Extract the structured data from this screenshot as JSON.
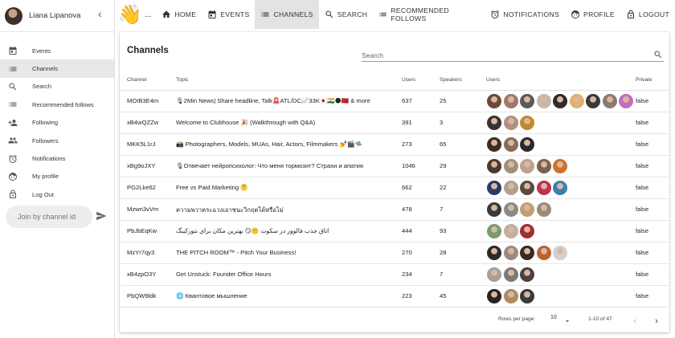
{
  "sidebar": {
    "user_name": "Liana Lipanova",
    "items": [
      {
        "label": "Events",
        "icon": "calendar-icon"
      },
      {
        "label": "Channels",
        "icon": "list-icon",
        "active": true
      },
      {
        "label": "Search",
        "icon": "search-icon"
      },
      {
        "label": "Recommended follows",
        "icon": "list-icon"
      },
      {
        "label": "Following",
        "icon": "person-add-icon"
      },
      {
        "label": "Followers",
        "icon": "people-icon"
      },
      {
        "label": "Notifications",
        "icon": "alarm-icon"
      },
      {
        "label": "My profile",
        "icon": "face-icon"
      },
      {
        "label": "Log Out",
        "icon": "lock-icon"
      }
    ],
    "join_placeholder": "Join by channel id"
  },
  "topnav": {
    "ellipsis": "...",
    "items": [
      {
        "label": "HOME",
        "icon": "home-icon"
      },
      {
        "label": "EVENTS",
        "icon": "calendar-icon"
      },
      {
        "label": "CHANNELS",
        "icon": "list-icon",
        "active": true
      },
      {
        "label": "SEARCH",
        "icon": "search-icon"
      },
      {
        "label": "RECOMMENDED FOLLOWS",
        "icon": "list-icon"
      },
      {
        "label": "NOTIFICATIONS",
        "icon": "alarm-icon"
      },
      {
        "label": "PROFILE",
        "icon": "face-icon"
      },
      {
        "label": "LOGOUT",
        "icon": "lock-icon"
      }
    ]
  },
  "main": {
    "title": "Channels",
    "search_placeholder": "Search",
    "columns": {
      "channel": "Channel",
      "topic": "Topic",
      "users": "Users",
      "speakers": "Speakers",
      "users_avatars": "Users",
      "private": "Private"
    },
    "rows": [
      {
        "channel": "MOIB3E4m",
        "topic": "🎙2Min News| Share headline, Talk🚨ATL/DC📈33K🇯🇵🇮🇳🌑🇲🇦 & more",
        "users": "637",
        "speakers": "25",
        "avatars": [
          "#6b4a3a",
          "#a07a68",
          "#5a5a5a",
          "#c9b8a8",
          "#2d2d2d",
          "#e0b070",
          "#3a3a3a",
          "#8a7a70",
          "#c070c0"
        ],
        "private": "false"
      },
      {
        "channel": "xB4wQZZw",
        "topic": "Welcome to Clubhouse 🎉 (Walkthrough with Q&A)",
        "users": "391",
        "speakers": "3",
        "avatars": [
          "#3a3030",
          "#b09080",
          "#c08a30"
        ],
        "private": "false"
      },
      {
        "channel": "MKK5L1rJ",
        "topic": "📸 Photographers, Models, MUAs, Hair, Actors, Filmmakers 💅🎬🛸",
        "users": "273",
        "speakers": "65",
        "avatars": [
          "#402a22",
          "#8a6a5a",
          "#2a2a2a"
        ],
        "private": "false"
      },
      {
        "channel": "xBg9oJXY",
        "topic": "🎙Отвечает нейропсихолог: Что меня тормозит? Страхи и апатия",
        "users": "1046",
        "speakers": "29",
        "avatars": [
          "#4a3a32",
          "#a09080",
          "#c0a090",
          "#7a6050",
          "#d07030"
        ],
        "private": "false"
      },
      {
        "channel": "PG2Lke62",
        "topic": "Free vs Paid Marketing 🤔",
        "users": "662",
        "speakers": "22",
        "avatars": [
          "#2a3a6a",
          "#b0a090",
          "#5a4a40",
          "#c03050",
          "#3a80b0"
        ],
        "private": "false"
      },
      {
        "channel": "Mzwn3vVm",
        "topic": "ความพวาคระแวงเอาชนะวิกฤตได้หรือไม่",
        "users": "478",
        "speakers": "7",
        "avatars": [
          "#3a3a3a",
          "#8a8a8a",
          "#c0a070",
          "#9a8a7a"
        ],
        "private": "false"
      },
      {
        "channel": "PbJbEqKw",
        "topic": "اتاق جذب فالوور در سکوت 🤫😏 بهترین مکان برای نتورکینگ",
        "users": "444",
        "speakers": "93",
        "avatars": [
          "#7a9a70",
          "#c0b0a0",
          "#a03030"
        ],
        "private": "false"
      },
      {
        "channel": "MzYr7qy3",
        "topic": "THE PITCH ROOM™ - Pitch Your Business!",
        "users": "270",
        "speakers": "28",
        "avatars": [
          "#2a2a2a",
          "#9a8a80",
          "#3a2a22",
          "#c06030",
          "#d0d0d0"
        ],
        "private": "false"
      },
      {
        "channel": "xB4zpO3Y",
        "topic": "Get Unstuck: Founder Office Hours",
        "users": "234",
        "speakers": "7",
        "avatars": [
          "#a0a0a0",
          "#7a7a7a",
          "#4a4040"
        ],
        "private": "false"
      },
      {
        "channel": "PbQW9ldk",
        "topic": "🌐 Квантовое мышление",
        "users": "223",
        "speakers": "45",
        "avatars": [
          "#2a2222",
          "#b08a60",
          "#3a3a3a"
        ],
        "private": "false"
      }
    ],
    "pagination": {
      "rows_per_page_label": "Rows per page:",
      "rows_per_page": "10",
      "range": "1-10 of 47"
    }
  }
}
